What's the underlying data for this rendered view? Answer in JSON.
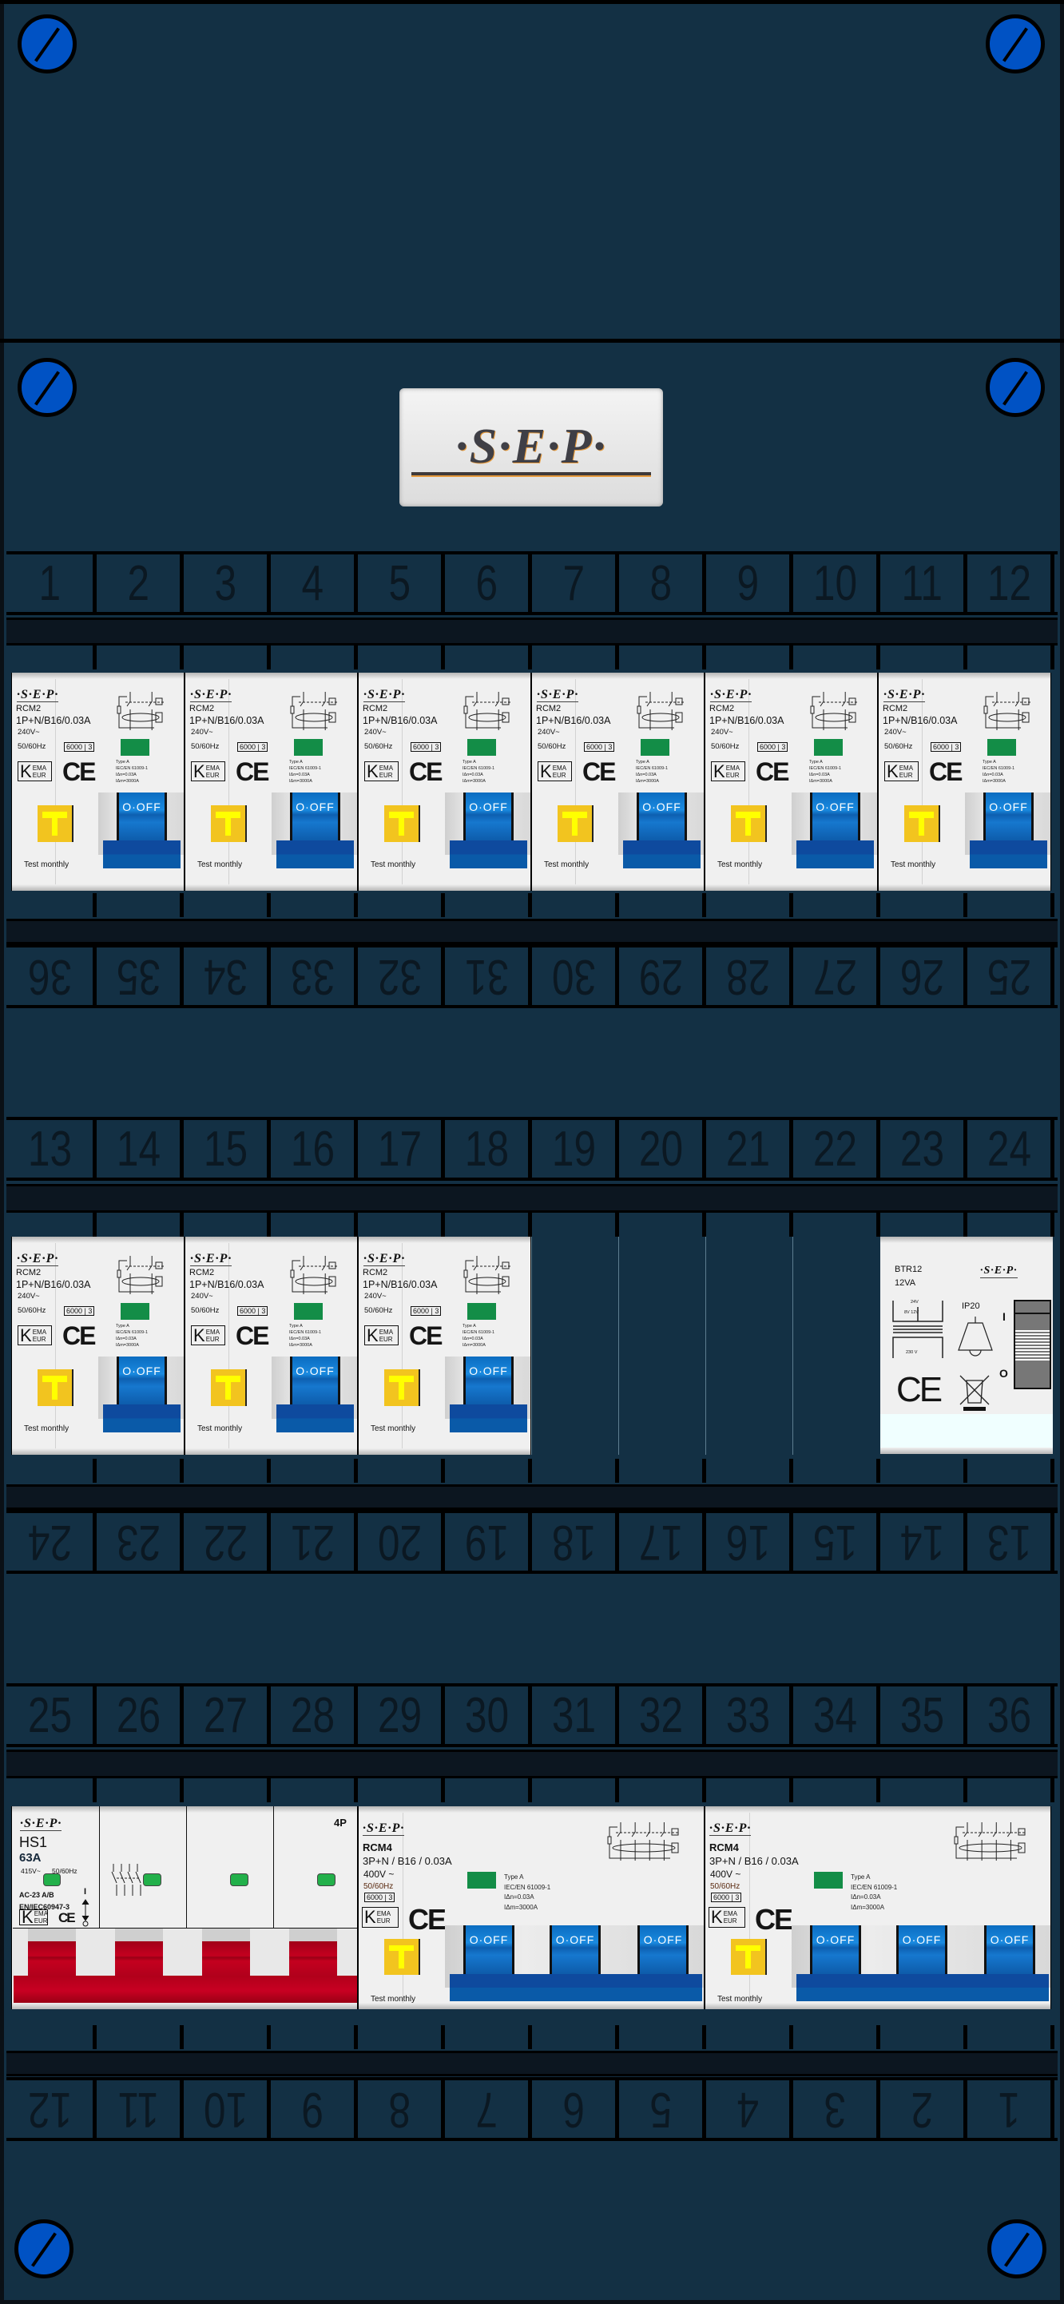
{
  "brand": "·S·E·P·",
  "strips": [
    {
      "inverted": false,
      "numbers": [
        "1",
        "2",
        "3",
        "4",
        "5",
        "6",
        "7",
        "8",
        "9",
        "10",
        "11",
        "12"
      ]
    },
    {
      "inverted": true,
      "numbers": [
        "36",
        "35",
        "34",
        "33",
        "32",
        "31",
        "30",
        "29",
        "28",
        "27",
        "26",
        "25"
      ]
    },
    {
      "inverted": false,
      "numbers": [
        "13",
        "14",
        "15",
        "16",
        "17",
        "18",
        "19",
        "20",
        "21",
        "22",
        "23",
        "24"
      ]
    },
    {
      "inverted": true,
      "numbers": [
        "24",
        "23",
        "22",
        "21",
        "20",
        "19",
        "18",
        "17",
        "16",
        "15",
        "14",
        "13"
      ]
    },
    {
      "inverted": false,
      "numbers": [
        "25",
        "26",
        "27",
        "28",
        "29",
        "30",
        "31",
        "32",
        "33",
        "34",
        "35",
        "36"
      ]
    },
    {
      "inverted": true,
      "numbers": [
        "12",
        "11",
        "10",
        "9",
        "8",
        "7",
        "6",
        "5",
        "4",
        "3",
        "2",
        "1"
      ]
    }
  ],
  "devices": {
    "rcm2": {
      "logo": "·S·E·P·",
      "model": "RCM2",
      "rating": "1P+N/B16/0.03A",
      "voltage": "240V~",
      "freq": "50/60Hz",
      "breaking": "6000",
      "class": "3",
      "kema_k": "K",
      "kema_top": "EMA",
      "kema_bottom": "EUR",
      "ce": "CE",
      "type": "Type A",
      "standard": "IEC/EN 61009-1",
      "idn": "IΔn=0.03A",
      "idm": "IΔm=3000A",
      "switch": "O·OFF",
      "test_note": "Test  monthly"
    },
    "rcm4": {
      "logo": "·S·E·P·",
      "model": "RCM4",
      "rating": "3P+N / B16 / 0.03A",
      "voltage": "400V ~",
      "freq": "50/60Hz",
      "breaking": "6000",
      "class": "3",
      "kema_k": "K",
      "kema_top": "EMA",
      "kema_bottom": "EUR",
      "ce": "CE",
      "type": "Type A",
      "standard": "IEC/EN 61009-1",
      "idn": "IΔn=0.03A",
      "idm": "IΔm=3000A",
      "switch": "O·OFF",
      "test_note": "Test  monthly"
    },
    "hs1": {
      "logo": "·S·E·P·",
      "model": "HS1",
      "current": "63A",
      "voltage": "415V~",
      "freq": "50/60Hz",
      "category": "AC-23 A/B",
      "standard": "EN/IEC60947-3",
      "kema_k": "K",
      "kema_top": "EMA",
      "kema_bottom": "EUR",
      "ce": "CE",
      "poles": "4P",
      "on": "I"
    },
    "btr12": {
      "logo": "·S·E·P·",
      "model": "BTR12",
      "power": "12VA",
      "v_secondary": "24V",
      "v_taps": "8V  12V",
      "v_primary": "230  V",
      "ip": "IP20",
      "on": "I",
      "off": "O",
      "ce": "CE"
    }
  },
  "rows": [
    {
      "devices": [
        "rcm2",
        "rcm2",
        "rcm2",
        "rcm2",
        "rcm2",
        "rcm2"
      ]
    },
    {
      "devices": [
        "rcm2",
        "rcm2",
        "rcm2",
        "empty",
        "empty",
        "empty",
        "empty",
        "btr12"
      ]
    },
    {
      "devices": [
        "hs1",
        "rcm4",
        "rcm4"
      ]
    }
  ],
  "colors": {
    "panel": "#133044",
    "switch_blue": "#0b6cc0",
    "main_switch_red": "#c4001f",
    "test_yellow": "#f2c41f",
    "indicator_green": "#138d47",
    "screw_blue": "#0052c4"
  }
}
